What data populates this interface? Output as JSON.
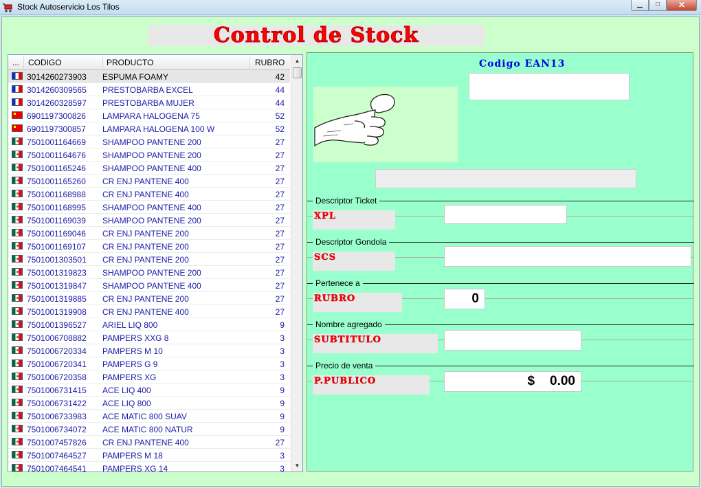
{
  "window": {
    "title": "Stock Autoservicio Los Tilos",
    "min_glyph": "▁",
    "max_glyph": "□",
    "close_glyph": "✕"
  },
  "header": {
    "title": "Control de Stock"
  },
  "grid": {
    "columns": {
      "dots": "...",
      "code": "CODIGO",
      "product": "PRODUCTO",
      "rubro": "RUBRO"
    },
    "rows": [
      {
        "flag": "fr",
        "code": "3014260273903",
        "product": "ESPUMA FOAMY",
        "rubro": "42"
      },
      {
        "flag": "fr",
        "code": "3014260309565",
        "product": "PRESTOBARBA EXCEL",
        "rubro": "44"
      },
      {
        "flag": "fr",
        "code": "3014260328597",
        "product": "PRESTOBARBA MUJER",
        "rubro": "44"
      },
      {
        "flag": "cn",
        "code": "6901197300826",
        "product": "LAMPARA HALOGENA 75",
        "rubro": "52"
      },
      {
        "flag": "cn",
        "code": "6901197300857",
        "product": "LAMPARA HALOGENA 100 W",
        "rubro": "52"
      },
      {
        "flag": "mx",
        "code": "7501001164669",
        "product": "SHAMPOO PANTENE 200",
        "rubro": "27"
      },
      {
        "flag": "mx",
        "code": "7501001164676",
        "product": "SHAMPOO PANTENE 200",
        "rubro": "27"
      },
      {
        "flag": "mx",
        "code": "7501001165246",
        "product": "SHAMPOO PANTENE 400",
        "rubro": "27"
      },
      {
        "flag": "mx",
        "code": "7501001165260",
        "product": "CR ENJ PANTENE 400",
        "rubro": "27"
      },
      {
        "flag": "mx",
        "code": "7501001168988",
        "product": "CR ENJ PANTENE 400",
        "rubro": "27"
      },
      {
        "flag": "mx",
        "code": "7501001168995",
        "product": "SHAMPOO PANTENE 400",
        "rubro": "27"
      },
      {
        "flag": "mx",
        "code": "7501001169039",
        "product": "SHAMPOO PANTENE 200",
        "rubro": "27"
      },
      {
        "flag": "mx",
        "code": "7501001169046",
        "product": "CR ENJ PANTENE 200",
        "rubro": "27"
      },
      {
        "flag": "mx",
        "code": "7501001169107",
        "product": "CR ENJ PANTENE 200",
        "rubro": "27"
      },
      {
        "flag": "mx",
        "code": "7501001303501",
        "product": "CR ENJ PANTENE 200",
        "rubro": "27"
      },
      {
        "flag": "mx",
        "code": "7501001319823",
        "product": "SHAMPOO PANTENE 200",
        "rubro": "27"
      },
      {
        "flag": "mx",
        "code": "7501001319847",
        "product": "SHAMPOO PANTENE 400",
        "rubro": "27"
      },
      {
        "flag": "mx",
        "code": "7501001319885",
        "product": "CR ENJ PANTENE 200",
        "rubro": "27"
      },
      {
        "flag": "mx",
        "code": "7501001319908",
        "product": "CR ENJ PANTENE 400",
        "rubro": "27"
      },
      {
        "flag": "mx",
        "code": "7501001396527",
        "product": "ARIEL LIQ 800",
        "rubro": "9"
      },
      {
        "flag": "mx",
        "code": "7501006708882",
        "product": "PAMPERS XXG 8",
        "rubro": "3"
      },
      {
        "flag": "mx",
        "code": "7501006720334",
        "product": "PAMPERS M 10",
        "rubro": "3"
      },
      {
        "flag": "mx",
        "code": "7501006720341",
        "product": "PAMPERS G 9",
        "rubro": "3"
      },
      {
        "flag": "mx",
        "code": "7501006720358",
        "product": "PAMPERS XG",
        "rubro": "3"
      },
      {
        "flag": "mx",
        "code": "7501006731415",
        "product": "ACE LIQ 400",
        "rubro": "9"
      },
      {
        "flag": "mx",
        "code": "7501006731422",
        "product": "ACE LIQ 800",
        "rubro": "9"
      },
      {
        "flag": "mx",
        "code": "7501006733983",
        "product": "ACE MATIC 800 SUAV",
        "rubro": "9"
      },
      {
        "flag": "mx",
        "code": "7501006734072",
        "product": "ACE MATIC 800 NATUR",
        "rubro": "9"
      },
      {
        "flag": "mx",
        "code": "7501007457826",
        "product": "CR ENJ PANTENE 400",
        "rubro": "27"
      },
      {
        "flag": "mx",
        "code": "7501007464527",
        "product": "PAMPERS M 18",
        "rubro": "3"
      },
      {
        "flag": "mx",
        "code": "7501007464541",
        "product": "PAMPERS XG 14",
        "rubro": "3"
      }
    ],
    "scroll_up": "▲",
    "scroll_down": "▼"
  },
  "panel": {
    "ean_title": "Codigo EAN13",
    "ean_value": "",
    "description_value": "",
    "sections": {
      "ticket": {
        "caption": "Descriptor Ticket",
        "code": "XPL",
        "value": ""
      },
      "gondola": {
        "caption": "Descriptor Gondola",
        "code": "SCS",
        "value": ""
      },
      "rubro": {
        "caption": "Pertenece a",
        "code": "RUBRO",
        "value": "0"
      },
      "agregado": {
        "caption": "Nombre agregado",
        "code": "SUBTITULO",
        "value": ""
      },
      "precio": {
        "caption": "Precio de venta",
        "code": "P.PUBLICO",
        "currency": "$",
        "value": "0.00"
      }
    }
  },
  "colors": {
    "panel_bg": "#99ffcc",
    "client_bg": "#ccffcc",
    "title_red": "#ff0000",
    "ean_blue": "#0000ee",
    "row_text": "#1a1aa8"
  }
}
